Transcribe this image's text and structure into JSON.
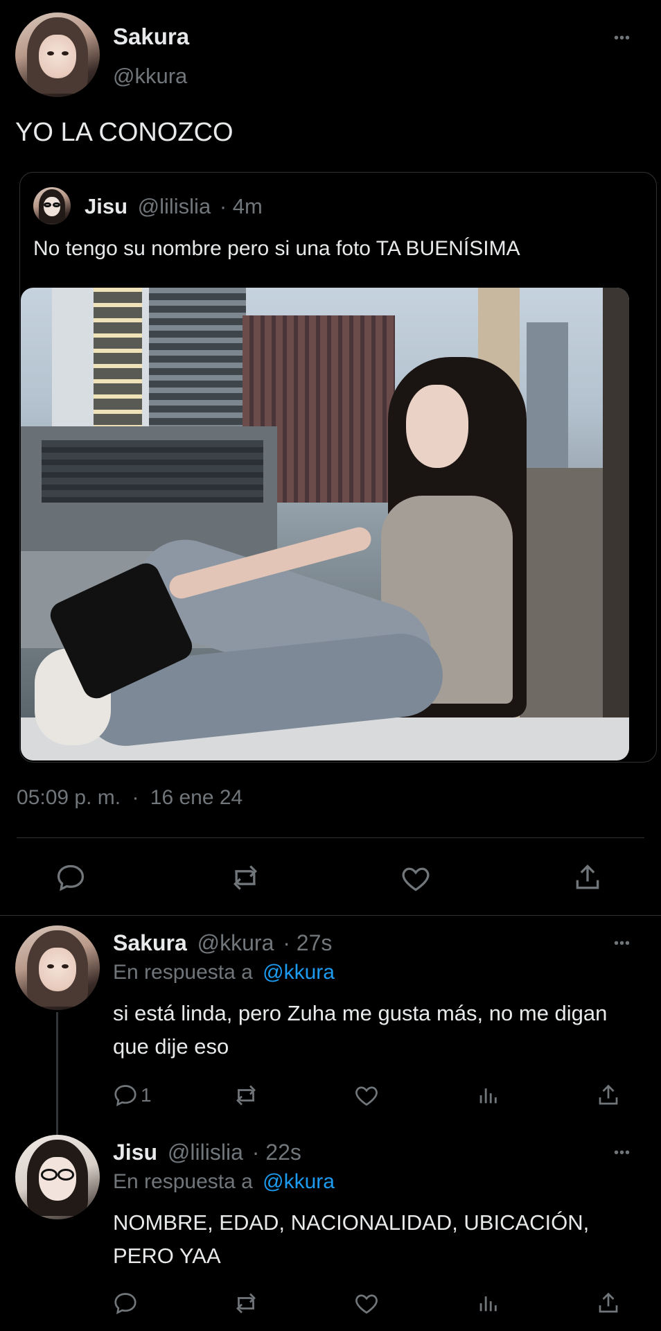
{
  "main_tweet": {
    "author_name": "Sakura",
    "author_handle": "@kkura",
    "text": "YO LA CONOZCO",
    "more_label": "•••",
    "timestamp": "05:09 p. m.",
    "separator": "·",
    "date": "16 ene 24"
  },
  "quoted_tweet": {
    "author_name": "Jisu",
    "author_handle": "@lilislia",
    "time": "· 4m",
    "text": "No tengo su nombre pero si una foto TA BUENÍSIMA"
  },
  "replies": [
    {
      "author_name": "Sakura",
      "author_handle": "@kkura",
      "time": "· 27s",
      "reply_prefix": "En respuesta a",
      "reply_to": "@kkura",
      "text": "si está linda, pero Zuha me gusta más, no me digan que dije eso",
      "reply_count": "1",
      "more_label": "•••"
    },
    {
      "author_name": "Jisu",
      "author_handle": "@lilislia",
      "time": "· 22s",
      "reply_prefix": "En respuesta a",
      "reply_to": "@kkura",
      "text": "NOMBRE, EDAD, NACIONALIDAD, UBICACIÓN, PERO YAA",
      "reply_count": "",
      "more_label": "•••"
    }
  ],
  "icons": [
    "reply-icon",
    "retweet-icon",
    "like-icon",
    "share-icon",
    "analytics-icon",
    "more-icon"
  ],
  "colors": {
    "background": "#000000",
    "text": "#e7e9ea",
    "muted": "#71767b",
    "link": "#1d9bf0",
    "divider": "#2f3336"
  }
}
